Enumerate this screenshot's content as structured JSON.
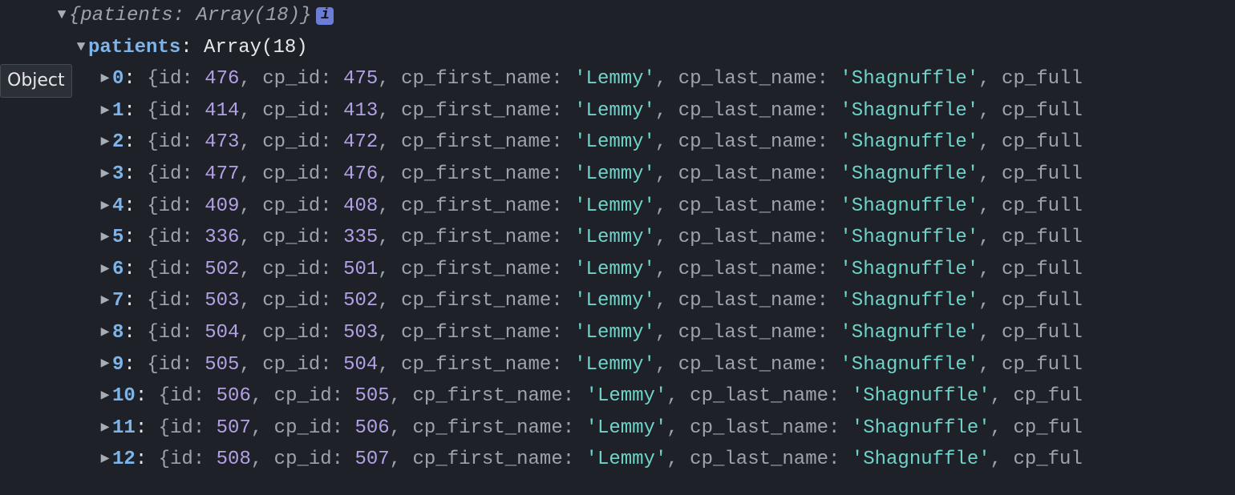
{
  "tooltip": "Object",
  "info_badge": "i",
  "root_summary": {
    "open_brace": "{",
    "key": "patients",
    "sep": ": ",
    "value": "Array(18)",
    "close_brace": "}"
  },
  "patients_label": "patients",
  "patients_value": "Array(18)",
  "field_labels": {
    "id": "id",
    "cp_id": "cp_id",
    "cp_first_name": "cp_first_name",
    "cp_last_name": "cp_last_name",
    "cp_full": "cp_full",
    "cp_ful": "cp_ful"
  },
  "rows": [
    {
      "idx": "0",
      "id": 476,
      "cp_id": 475,
      "fn": "Lemmy",
      "ln": "Shagnuffle",
      "trail": "cp_full"
    },
    {
      "idx": "1",
      "id": 414,
      "cp_id": 413,
      "fn": "Lemmy",
      "ln": "Shagnuffle",
      "trail": "cp_full"
    },
    {
      "idx": "2",
      "id": 473,
      "cp_id": 472,
      "fn": "Lemmy",
      "ln": "Shagnuffle",
      "trail": "cp_full"
    },
    {
      "idx": "3",
      "id": 477,
      "cp_id": 476,
      "fn": "Lemmy",
      "ln": "Shagnuffle",
      "trail": "cp_full"
    },
    {
      "idx": "4",
      "id": 409,
      "cp_id": 408,
      "fn": "Lemmy",
      "ln": "Shagnuffle",
      "trail": "cp_full"
    },
    {
      "idx": "5",
      "id": 336,
      "cp_id": 335,
      "fn": "Lemmy",
      "ln": "Shagnuffle",
      "trail": "cp_full"
    },
    {
      "idx": "6",
      "id": 502,
      "cp_id": 501,
      "fn": "Lemmy",
      "ln": "Shagnuffle",
      "trail": "cp_full"
    },
    {
      "idx": "7",
      "id": 503,
      "cp_id": 502,
      "fn": "Lemmy",
      "ln": "Shagnuffle",
      "trail": "cp_full"
    },
    {
      "idx": "8",
      "id": 504,
      "cp_id": 503,
      "fn": "Lemmy",
      "ln": "Shagnuffle",
      "trail": "cp_full"
    },
    {
      "idx": "9",
      "id": 505,
      "cp_id": 504,
      "fn": "Lemmy",
      "ln": "Shagnuffle",
      "trail": "cp_full"
    },
    {
      "idx": "10",
      "id": 506,
      "cp_id": 505,
      "fn": "Lemmy",
      "ln": "Shagnuffle",
      "trail": "cp_ful"
    },
    {
      "idx": "11",
      "id": 507,
      "cp_id": 506,
      "fn": "Lemmy",
      "ln": "Shagnuffle",
      "trail": "cp_ful"
    },
    {
      "idx": "12",
      "id": 508,
      "cp_id": 507,
      "fn": "Lemmy",
      "ln": "Shagnuffle",
      "trail": "cp_ful"
    }
  ]
}
